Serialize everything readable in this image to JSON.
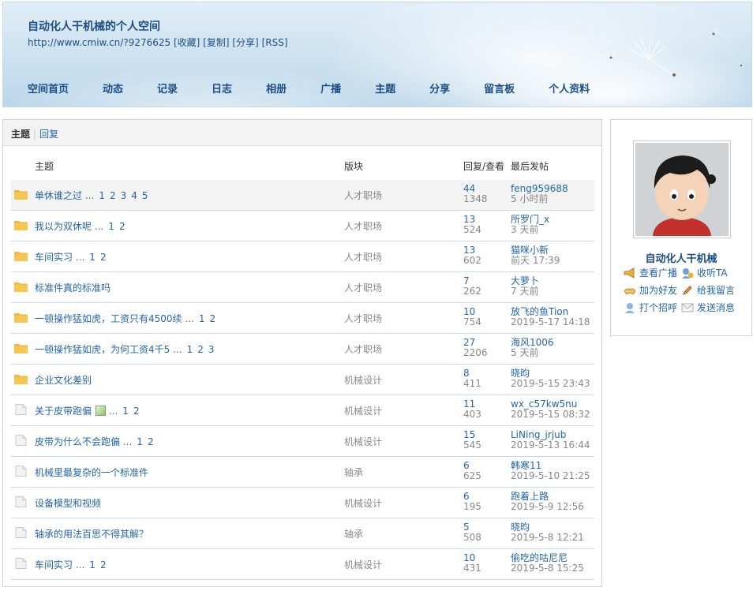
{
  "header": {
    "title": "自动化人干机械的个人空间",
    "url": "http://www.cmiw.cn/?9276625",
    "links": [
      "[收藏]",
      "[复制]",
      "[分享]",
      "[RSS]"
    ],
    "nav": [
      "空间首页",
      "动态",
      "记录",
      "日志",
      "相册",
      "广播",
      "主题",
      "分享",
      "留言板",
      "个人资料"
    ]
  },
  "tabs": {
    "active": "主题",
    "other": "回复"
  },
  "columns": {
    "subject": "主题",
    "forum": "版块",
    "replies_views": "回复/查看",
    "last_post": "最后发帖"
  },
  "threads": [
    {
      "title": "单休谁之过",
      "pages": [
        "1",
        "2",
        "3",
        "4",
        "5"
      ],
      "forum": "人才职场",
      "replies": "44",
      "views": "1348",
      "user": "feng959688",
      "time": "5 小时前",
      "icon": "folder-icon",
      "highlight": true
    },
    {
      "title": "我以为双休呢",
      "pages": [
        "1",
        "2"
      ],
      "forum": "人才职场",
      "replies": "13",
      "views": "524",
      "user": "所罗门_x",
      "time": "3 天前",
      "icon": "folder-icon"
    },
    {
      "title": "车间实习",
      "pages": [
        "1",
        "2"
      ],
      "forum": "人才职场",
      "replies": "13",
      "views": "602",
      "user": "猫咪小新",
      "time": "前天 17:39",
      "icon": "folder-icon"
    },
    {
      "title": "标准件真的标准吗",
      "pages": [],
      "forum": "人才职场",
      "replies": "7",
      "views": "262",
      "user": "大萝卜",
      "time": "7 天前",
      "icon": "folder-icon"
    },
    {
      "title": "一顿操作猛如虎，工资只有4500续",
      "pages": [
        "1",
        "2"
      ],
      "forum": "人才职场",
      "replies": "10",
      "views": "754",
      "user": "放飞的鱼Tion",
      "time": "2019-5-17 14:18",
      "icon": "folder-icon"
    },
    {
      "title": "一顿操作猛如虎，为何工资4千5",
      "pages": [
        "1",
        "2",
        "3"
      ],
      "forum": "人才职场",
      "replies": "27",
      "views": "2206",
      "user": "海风1006",
      "time": "5 天前",
      "icon": "folder-icon"
    },
    {
      "title": "企业文化差别",
      "pages": [],
      "forum": "机械设计",
      "replies": "8",
      "views": "411",
      "user": "晓昀",
      "time": "2019-5-15 23:43",
      "icon": "folder-icon"
    },
    {
      "title": "关于皮带跑偏",
      "pages": [
        "1",
        "2"
      ],
      "forum": "机械设计",
      "replies": "11",
      "views": "403",
      "user": "wx_c57kw5nu",
      "time": "2019-5-15 08:32",
      "icon": "document-icon",
      "has_image": true
    },
    {
      "title": "皮带为什么不会跑偏",
      "pages": [
        "1",
        "2"
      ],
      "forum": "机械设计",
      "replies": "15",
      "views": "545",
      "user": "LiNing_jrjub",
      "time": "2019-5-13 16:44",
      "icon": "document-icon"
    },
    {
      "title": "机械里最复杂的一个标准件",
      "pages": [],
      "forum": "轴承",
      "replies": "6",
      "views": "625",
      "user": "韩寒11",
      "time": "2019-5-10 21:25",
      "icon": "document-icon"
    },
    {
      "title": "设备模型和视频",
      "pages": [],
      "forum": "机械设计",
      "replies": "6",
      "views": "195",
      "user": "跑着上路",
      "time": "2019-5-9 12:56",
      "icon": "document-icon"
    },
    {
      "title": "轴承的用法百思不得其解？",
      "pages": [],
      "forum": "轴承",
      "replies": "5",
      "views": "508",
      "user": "晓昀",
      "time": "2019-5-8 12:21",
      "icon": "document-icon"
    },
    {
      "title": "车间实习",
      "pages": [
        "1",
        "2"
      ],
      "forum": "机械设计",
      "replies": "10",
      "views": "431",
      "user": "偷吃的咕尼尼",
      "time": "2019-5-8 15:25",
      "icon": "document-icon"
    }
  ],
  "ellipsis": "...",
  "profile": {
    "name": "自动化人干机械",
    "actions": [
      {
        "label": "查看广播",
        "icon": "megaphone-icon"
      },
      {
        "label": "收听TA",
        "icon": "listen-icon"
      },
      {
        "label": "加为好友",
        "icon": "add-friend-icon"
      },
      {
        "label": "给我留言",
        "icon": "pencil-icon"
      },
      {
        "label": "打个招呼",
        "icon": "greet-icon"
      },
      {
        "label": "发送消息",
        "icon": "envelope-icon"
      }
    ]
  },
  "colors": {
    "link": "#2366a8",
    "title": "#1d4f86",
    "folder": "#f4b73a",
    "muted": "#888888"
  }
}
